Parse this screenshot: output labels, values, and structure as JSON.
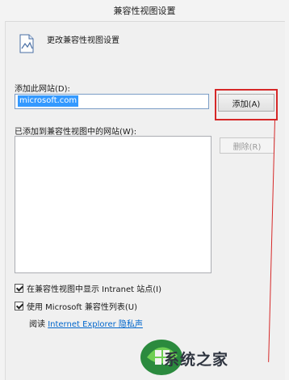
{
  "window": {
    "title": "兼容性视图设置"
  },
  "header": {
    "text": "更改兼容性视图设置",
    "icon": "page-settings-icon"
  },
  "add_site": {
    "label": "添加此网站(D):",
    "input_value": "microsoft.com",
    "button_label": "添加(A)"
  },
  "sites": {
    "label": "已添加到兼容性视图中的网站(W):",
    "items": [],
    "remove_label": "删除(R)"
  },
  "options": {
    "intranet_label": "在兼容性视图中显示 Intranet 站点(I)",
    "intranet_checked": true,
    "mslist_label": "使用 Microsoft 兼容性列表(U)",
    "mslist_checked": true
  },
  "footer": {
    "read_prefix": "阅读",
    "link_text": "Internet Explorer 隐私声"
  },
  "watermark": {
    "text": "系统之家"
  },
  "colors": {
    "highlight": "#d62828",
    "selection": "#3399ff",
    "link": "#0066cc"
  }
}
